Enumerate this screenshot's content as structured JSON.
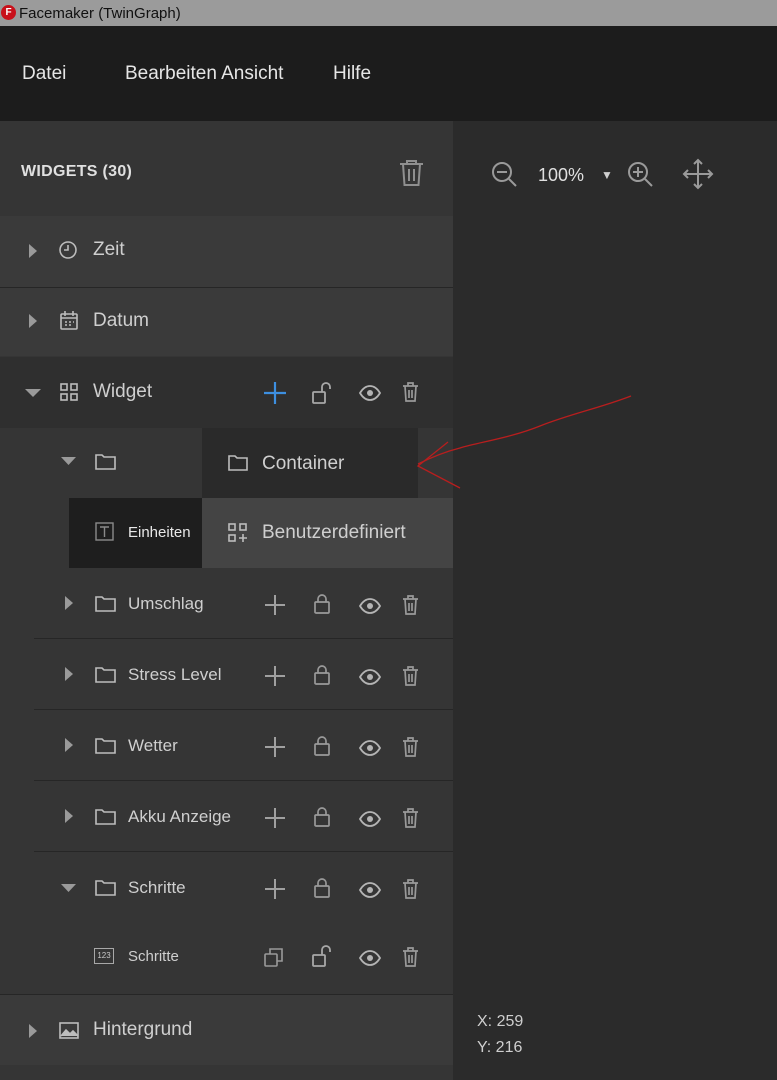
{
  "window": {
    "app_icon_letter": "F",
    "title": "Facemaker (TwinGraph)"
  },
  "menu": {
    "file": "Datei",
    "edit_view": "Bearbeiten Ansicht",
    "help": "Hilfe"
  },
  "widgets_panel": {
    "header": "WIDGETS  (30)",
    "items": {
      "zeit": "Zeit",
      "datum": "Datum",
      "widget": "Widget",
      "einheiten": "Einheiten",
      "umschlag": "Umschlag",
      "stress_level": "Stress Level",
      "wetter": "Wetter",
      "akku_anzeige": "Akku Anzeige",
      "schritte_folder": "Schritte",
      "schritte_value": "Schritte",
      "hintergrund": "Hintergrund"
    },
    "add_dropdown": {
      "container": "Container",
      "custom": "Benutzerdefiniert"
    },
    "value_icon_text": "123"
  },
  "canvas": {
    "zoom": "100%",
    "zoom_caret": "▼",
    "coord_x": "X: 259",
    "coord_y": "Y: 216"
  },
  "colors": {
    "accent_blue": "#3d8fe0",
    "annotation_red": "#b81e1e"
  }
}
